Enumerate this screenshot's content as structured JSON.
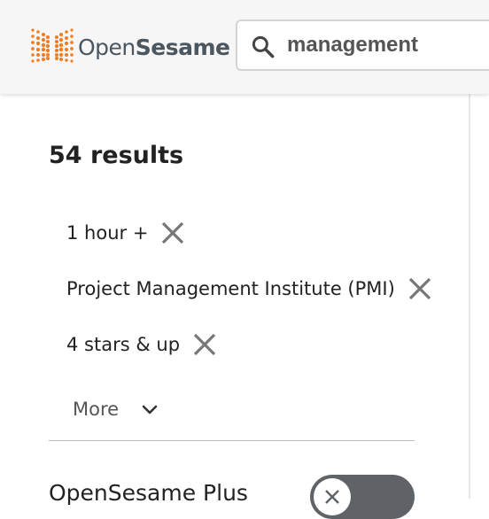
{
  "header": {
    "logo_text_regular": "Open",
    "logo_text_bold": "Sesame",
    "search": {
      "value": "management",
      "placeholder": ""
    }
  },
  "results": {
    "count_label": "54 results"
  },
  "filters": [
    {
      "label": "1 hour +"
    },
    {
      "label": "Project Management Institute (PMI)"
    },
    {
      "label": "4 stars & up"
    }
  ],
  "more_label": "More",
  "plus_toggle": {
    "label": "OpenSesame Plus",
    "state": "off"
  },
  "colors": {
    "logo_orange": "#f07d22",
    "toggle_bg": "#5f6368",
    "header_bg": "#f6f6f6"
  },
  "icons": {
    "search": "search-icon",
    "remove": "close-icon",
    "more": "chevron-down-icon"
  }
}
